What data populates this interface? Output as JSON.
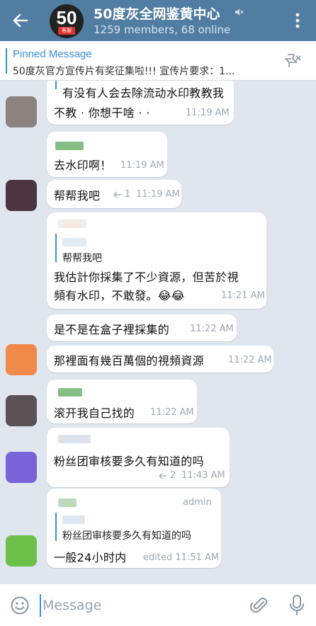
{
  "header": {
    "title": "50度灰全网鉴黄中心",
    "subtitle": "1259 members, 68 online",
    "avatar_text": "50",
    "avatar_badge": "客服"
  },
  "pinned": {
    "label": "Pinned Message",
    "text": "50度灰官方宣传片有奖征集啦!!!  宣传片要求：1..."
  },
  "messages": [
    {
      "text1": "有没有人会去除流动水印教教我",
      "text2": "不教 · 你想干啥 · ·",
      "time": "11:19 AM"
    },
    {
      "text": "去水印啊！",
      "time": "11:19 AM"
    },
    {
      "text": "帮帮我吧",
      "replies": "1",
      "time": "11:19 AM"
    },
    {
      "reply_text": "帮帮我吧",
      "text1": "我估計你採集了不少資源，但苦於視",
      "text2": "頻有水印，不敢發。😂😂",
      "time": "11:21 AM"
    },
    {
      "text": "是不是在盒子裡採集的",
      "time": "11:22 AM"
    },
    {
      "text": "那裡面有幾百萬個的視頻資源",
      "time": "11:22 AM"
    },
    {
      "text": "滚开我自己找的",
      "time": "11:22 AM"
    },
    {
      "text": "粉丝团审核要多久有知道的吗",
      "replies": "2",
      "time": "11:43 AM"
    },
    {
      "role": "admin",
      "reply_text": "粉丝团审核要多久有知道的吗",
      "text": "一般24小时内",
      "time": "edited 11:51 AM"
    }
  ],
  "composer": {
    "placeholder": "Message"
  },
  "colors": {
    "header": "#517da2",
    "accent": "#3a8fd9",
    "chat_bg": "#dfe6ee"
  }
}
